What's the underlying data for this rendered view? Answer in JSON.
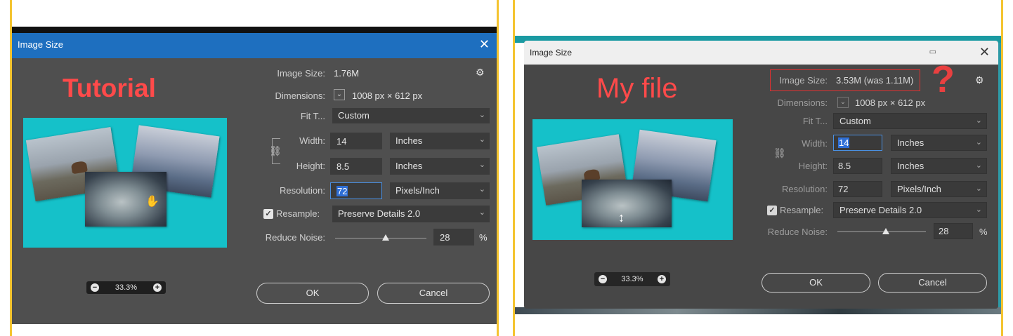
{
  "left": {
    "dialog_title": "Image Size",
    "close_glyph": "✕",
    "overlay_label": "Tutorial",
    "image_size_label": "Image Size:",
    "image_size_value": "1.76M",
    "dimensions_label": "Dimensions:",
    "dimensions_value": "1008 px  ×  612 px",
    "fit_label": "Fit T...",
    "fit_value": "Custom",
    "width_label": "Width:",
    "width_value": "14",
    "width_unit": "Inches",
    "height_label": "Height:",
    "height_value": "8.5",
    "height_unit": "Inches",
    "resolution_label": "Resolution:",
    "resolution_value": "72",
    "resolution_unit": "Pixels/Inch",
    "resample_label": "Resample:",
    "resample_value": "Preserve Details 2.0",
    "noise_label": "Reduce Noise:",
    "noise_value": "28",
    "noise_unit": "%",
    "noise_level": 0.55,
    "zoom_value": "33.3%",
    "ok_label": "OK",
    "cancel_label": "Cancel"
  },
  "right": {
    "dialog_title": "Image Size",
    "close_glyph": "✕",
    "overlay_label": "My file",
    "image_size_label": "Image Size:",
    "image_size_value": "3.53M (was 1.11M)",
    "question_mark": "?",
    "dimensions_label": "Dimensions:",
    "dimensions_value": "1008 px  ×  612 px",
    "fit_label": "Fit T...",
    "fit_value": "Custom",
    "width_label": "Width:",
    "width_value": "14",
    "width_unit": "Inches",
    "height_label": "Height:",
    "height_value": "8.5",
    "height_unit": "Inches",
    "resolution_label": "Resolution:",
    "resolution_value": "72",
    "resolution_unit": "Pixels/Inch",
    "resample_label": "Resample:",
    "resample_value": "Preserve Details 2.0",
    "noise_label": "Reduce Noise:",
    "noise_value": "28",
    "noise_unit": "%",
    "noise_level": 0.55,
    "zoom_value": "33.3%",
    "ok_label": "OK",
    "cancel_label": "Cancel"
  },
  "colors": {
    "annotation_red": "#ff4a4a",
    "frame_yellow": "#f4c430",
    "preview_cyan": "#15c1c9",
    "title_blue": "#1e6fbf"
  },
  "icons": {
    "gear": "gear-icon",
    "link": "link-chain-icon",
    "dropdown": "chevron-down-icon",
    "hand": "hand-cursor-icon",
    "resize": "resize-vertical-icon"
  }
}
